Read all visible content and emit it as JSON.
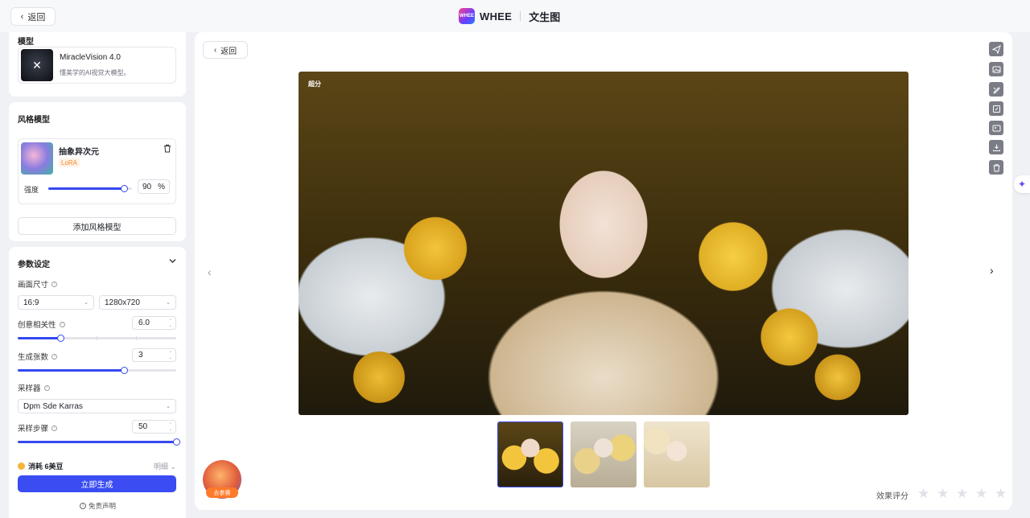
{
  "topbar": {
    "back_label": "返回",
    "logo_text": "WHEE",
    "brand_name": "WHEE",
    "page_title": "文生图"
  },
  "model_card": {
    "section_title": "模型",
    "model_name": "MiracleVision 4.0",
    "model_desc": "懂美学的AI视觉大模型。"
  },
  "style_card": {
    "section_title": "风格模型",
    "style_name": "抽象异次元",
    "style_tag": "LoRA",
    "strength_label": "强度",
    "strength_value": "90",
    "strength_unit": "%",
    "strength_level": 0.9,
    "add_label": "添加风格模型"
  },
  "params": {
    "section_title": "参数设定",
    "size_label": "画面尺寸",
    "ratio_value": "16:9",
    "resolution_value": "1280x720",
    "creativity_label": "创意相关性",
    "creativity_value": "6.0",
    "creativity_level": 0.27,
    "count_label": "生成张数",
    "count_value": "3",
    "count_level": 0.67,
    "sampler_label": "采样器",
    "sampler_value": "Dpm Sde Karras",
    "steps_label": "采样步骤",
    "steps_value": "50",
    "steps_level": 1.0
  },
  "footer": {
    "cost_label": "消耗 6美豆",
    "detail_label": "明细",
    "generate_label": "立即生成",
    "disclaimer_label": "免责声明"
  },
  "main": {
    "back_label": "返回",
    "image_badge": "超分",
    "rating_label": "效果评分",
    "stars": [
      "★",
      "★",
      "★",
      "★",
      "★"
    ]
  },
  "promo": {
    "tag_label": "去参赛"
  },
  "colors": {
    "accent": "#3a4cf2",
    "panel": "#ffffff",
    "background": "#f0f1f5",
    "tool_button": "#7a7d85",
    "lora_tag": "#f48a2b"
  }
}
